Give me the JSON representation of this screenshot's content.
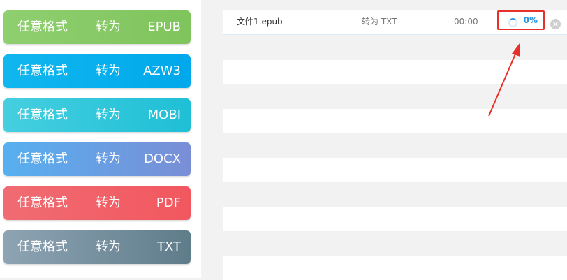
{
  "converters": [
    {
      "from": "任意格式",
      "to": "转为",
      "format": "EPUB"
    },
    {
      "from": "任意格式",
      "to": "转为",
      "format": "AZW3"
    },
    {
      "from": "任意格式",
      "to": "转为",
      "format": "MOBI"
    },
    {
      "from": "任意格式",
      "to": "转为",
      "format": "DOCX"
    },
    {
      "from": "任意格式",
      "to": "转为",
      "format": "PDF"
    },
    {
      "from": "任意格式",
      "to": "转为",
      "format": "TXT"
    }
  ],
  "files": [
    {
      "name": "文件1.epub",
      "target": "转为 TXT",
      "time": "00:00",
      "progress_text": "0%",
      "progress_value": 0
    }
  ],
  "colors": {
    "highlight": "#e8302a",
    "progress": "#2a95e0"
  },
  "icons": {
    "spinner": "loading-spinner-icon",
    "remove": "close-circle-icon"
  }
}
